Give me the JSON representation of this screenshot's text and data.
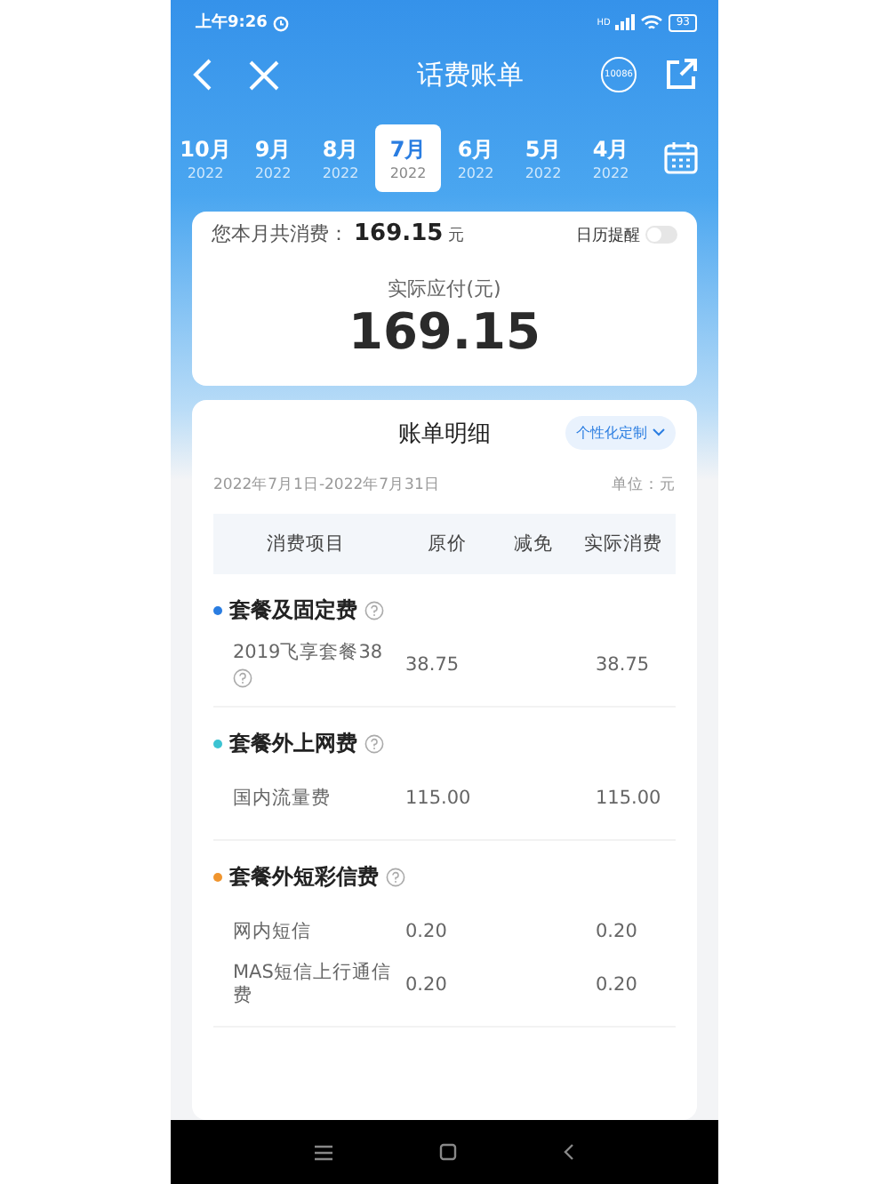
{
  "status_bar": {
    "time": "上午9:26",
    "network": "HD",
    "battery": "93"
  },
  "header": {
    "title": "话费账单",
    "service_badge": "10086"
  },
  "months": [
    {
      "label": "10月",
      "year": "2022",
      "selected": false
    },
    {
      "label": "9月",
      "year": "2022",
      "selected": false
    },
    {
      "label": "8月",
      "year": "2022",
      "selected": false
    },
    {
      "label": "7月",
      "year": "2022",
      "selected": true
    },
    {
      "label": "6月",
      "year": "2022",
      "selected": false
    },
    {
      "label": "5月",
      "year": "2022",
      "selected": false
    },
    {
      "label": "4月",
      "year": "2022",
      "selected": false
    }
  ],
  "summary": {
    "total_label": "您本月共消费：",
    "total": "169.15",
    "unit": "元",
    "reminder_label": "日历提醒",
    "reminder_on": false,
    "due_label": "实际应付(元)",
    "due": "169.15"
  },
  "detail": {
    "title": "账单明细",
    "custom_button": "个性化定制",
    "period": "2022年7月1日-2022年7月31日",
    "unit": "单位：元",
    "columns": [
      "消费项目",
      "原价",
      "减免",
      "实际消费"
    ],
    "groups": [
      {
        "name": "套餐及固定费",
        "color": "#2a7de1",
        "items": [
          {
            "name": "2019飞享套餐38",
            "help": true,
            "original": "38.75",
            "actual": "38.75"
          }
        ]
      },
      {
        "name": "套餐外上网费",
        "color": "#3cc3d2",
        "items": [
          {
            "name": "国内流量费",
            "help": false,
            "original": "115.00",
            "actual": "115.00"
          }
        ]
      },
      {
        "name": "套餐外短彩信费",
        "color": "#f0952e",
        "items": [
          {
            "name": "网内短信",
            "help": false,
            "original": "0.20",
            "actual": "0.20"
          },
          {
            "name": "MAS短信上行通信费",
            "help": false,
            "original": "0.20",
            "actual": "0.20"
          }
        ]
      }
    ]
  }
}
